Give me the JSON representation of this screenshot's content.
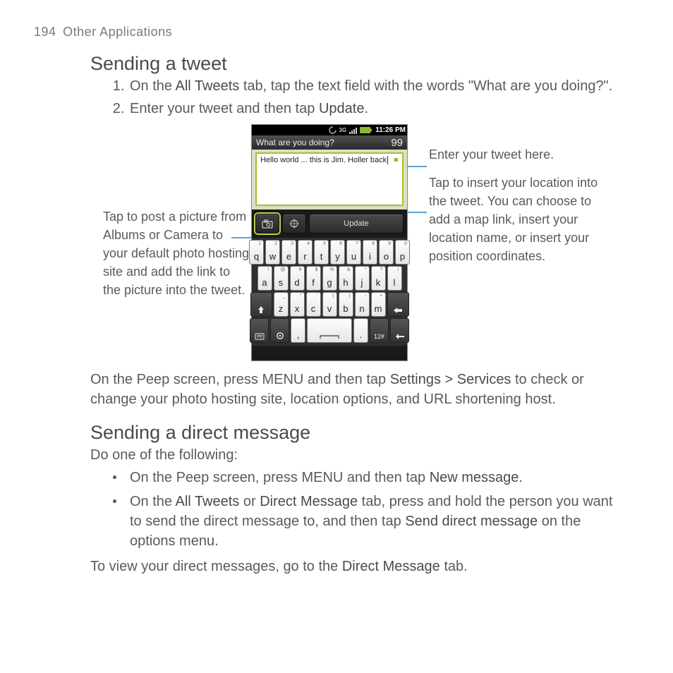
{
  "page": {
    "number": "194",
    "section": "Other Applications"
  },
  "s1": {
    "heading": "Sending a tweet",
    "li1": {
      "pre": "On the ",
      "b1": "All Tweets",
      "post": " tab, tap the text field with the words \"What are you doing?\"."
    },
    "li2": {
      "pre": "Enter your tweet and then tap ",
      "b1": "Update",
      "post": "."
    },
    "after_fig": {
      "t1": "On the Peep screen, press MENU and then tap ",
      "b1": "Settings > Services",
      "t2": " to check or change your photo hosting site, location options, and URL shortening host."
    }
  },
  "callouts": {
    "left": "Tap to post a picture from Albums or Camera to your default photo hosting site and add the link to the picture into the tweet.",
    "right1": "Enter your tweet here.",
    "right2": "Tap to insert your location into the tweet. You can choose to add a map link, insert your location name, or insert your position coordinates."
  },
  "phone": {
    "time": "11:26 PM",
    "title": "What are you doing?",
    "count": "99",
    "tweet_text": "Hello world ... this is Jim. Holler back",
    "update_label": "Update",
    "row1": [
      {
        "m": "q",
        "s": "1"
      },
      {
        "m": "w",
        "s": "2"
      },
      {
        "m": "e",
        "s": "3"
      },
      {
        "m": "r",
        "s": "4"
      },
      {
        "m": "t",
        "s": "5"
      },
      {
        "m": "y",
        "s": "6"
      },
      {
        "m": "u",
        "s": "7"
      },
      {
        "m": "i",
        "s": "8"
      },
      {
        "m": "o",
        "s": "9"
      },
      {
        "m": "p",
        "s": "0"
      }
    ],
    "row2": [
      {
        "m": "a",
        "s": "!"
      },
      {
        "m": "s",
        "s": "@"
      },
      {
        "m": "d",
        "s": "#"
      },
      {
        "m": "f",
        "s": "$"
      },
      {
        "m": "g",
        "s": "%"
      },
      {
        "m": "h",
        "s": "&"
      },
      {
        "m": "j",
        "s": "*"
      },
      {
        "m": "k",
        "s": "?"
      },
      {
        "m": "l",
        "s": "/"
      }
    ],
    "row3_letters": [
      {
        "m": "z",
        "s": "_"
      },
      {
        "m": "x",
        "s": "\""
      },
      {
        "m": "c",
        "s": "'"
      },
      {
        "m": "v",
        "s": "("
      },
      {
        "m": "b",
        "s": ")"
      },
      {
        "m": "n",
        "s": "-"
      },
      {
        "m": "m",
        "s": "+"
      }
    ],
    "row4": {
      "num": "12#"
    }
  },
  "s2": {
    "heading": "Sending a direct message",
    "intro": "Do one of the following:",
    "b1": {
      "t1": "On the Peep screen, press MENU and then tap ",
      "s1": "New message",
      "t2": "."
    },
    "b2": {
      "t1": "On the ",
      "s1": "All Tweets",
      "t2": " or ",
      "s2": "Direct Message",
      "t3": " tab, press and hold the person you want to send the direct message to, and then tap ",
      "s3": "Send direct message",
      "t4": " on the options menu."
    },
    "outro": {
      "t1": "To view your direct messages, go to the ",
      "s1": "Direct Message",
      "t2": " tab."
    }
  }
}
